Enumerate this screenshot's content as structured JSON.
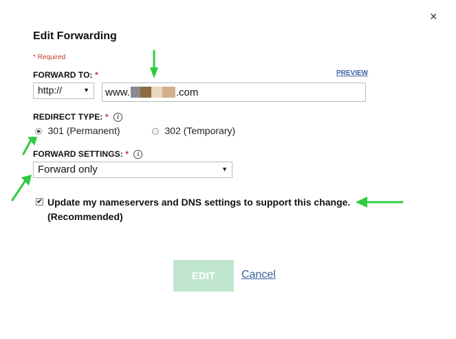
{
  "dialog": {
    "close_label": "×",
    "title": "Edit Forwarding",
    "required_note": "* Required"
  },
  "forward_to": {
    "label": "FORWARD TO:",
    "required_mark": "*",
    "preview_label": "PREVIEW",
    "protocol_value": "http://",
    "url_prefix": "www.",
    "url_suffix": ".com"
  },
  "redirect_type": {
    "label": "REDIRECT TYPE:",
    "required_mark": "*",
    "info_icon": "i",
    "options": [
      {
        "label": "301 (Permanent)",
        "selected": true
      },
      {
        "label": "302 (Temporary)",
        "selected": false
      }
    ]
  },
  "forward_settings": {
    "label": "FORWARD SETTINGS:",
    "required_mark": "*",
    "info_icon": "i",
    "selected_value": "Forward only"
  },
  "update_dns": {
    "checked": true,
    "label": "Update my nameservers and DNS settings to support this change. (Recommended)"
  },
  "actions": {
    "edit_label": "EDIT",
    "cancel_label": "Cancel"
  },
  "annotation_color": "#2ecc40",
  "brand_colors": {
    "required": "#c0392b",
    "link": "#3a5f9e",
    "button": "#bfe5cf"
  }
}
